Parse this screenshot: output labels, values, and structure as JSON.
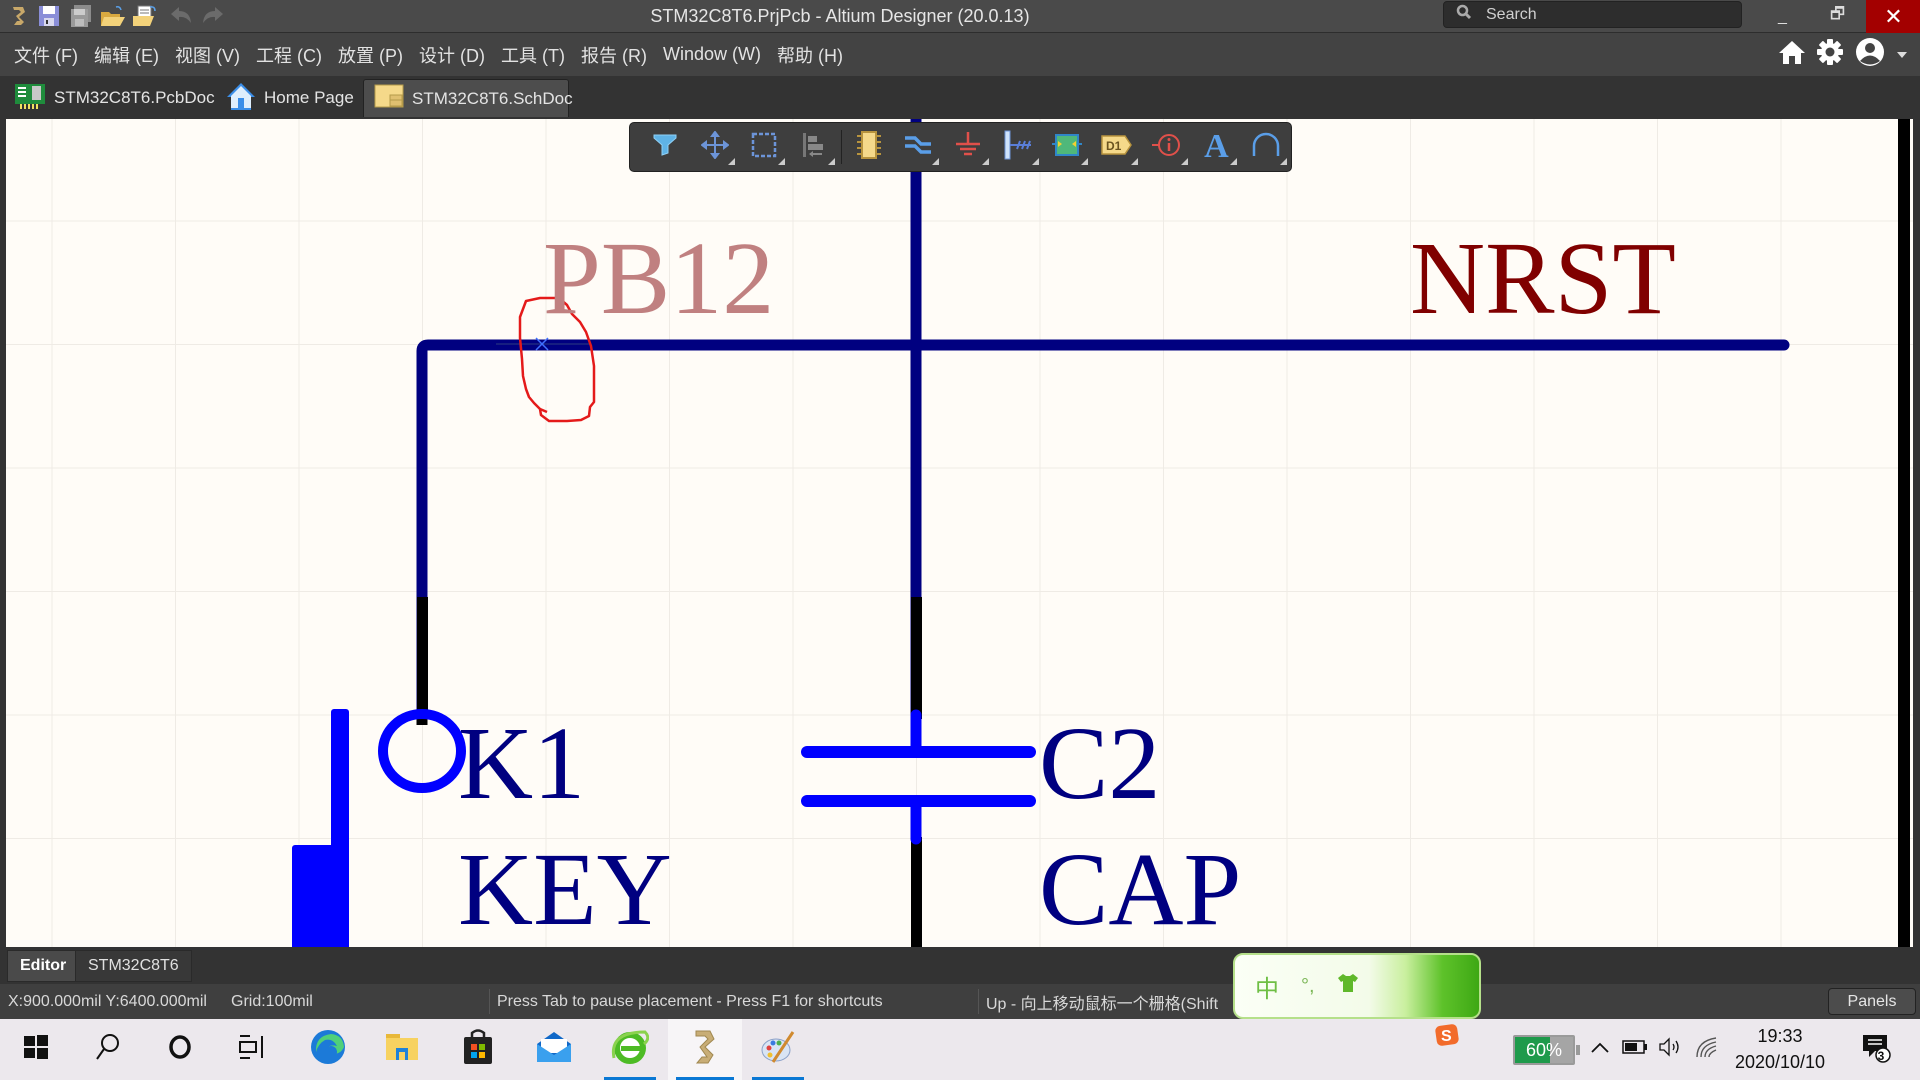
{
  "window": {
    "title": "STM32C8T6.PrjPcb - Altium Designer (20.0.13)",
    "search_placeholder": "Search",
    "minimize": "_",
    "restore": "🗗",
    "close": "✕"
  },
  "menu": {
    "items": [
      "文件 (F)",
      "编辑 (E)",
      "视图 (V)",
      "工程 (C)",
      "放置 (P)",
      "设计 (D)",
      "工具 (T)",
      "报告 (R)",
      "Window (W)",
      "帮助 (H)"
    ]
  },
  "doc_tabs": [
    {
      "label": "STM32C8T6.PcbDoc",
      "icon": "pcb-doc-icon",
      "active": false
    },
    {
      "label": "Home Page",
      "icon": "home-icon",
      "active": false
    },
    {
      "label": "STM32C8T6.SchDoc",
      "icon": "sch-doc-icon",
      "active": true
    }
  ],
  "toolbar": {
    "buttons": [
      "filter",
      "move",
      "select-rect",
      "align",
      "part",
      "wire",
      "ground",
      "bus",
      "sheet-symbol",
      "port",
      "directive",
      "text",
      "arc"
    ],
    "port_label": "D1",
    "text_glyph": "A"
  },
  "schematic": {
    "net_labels": [
      {
        "text": "PB12",
        "color": "#c08080"
      },
      {
        "text": "NRST",
        "color": "#800000"
      }
    ],
    "components": [
      {
        "designator": "K1",
        "comment": "KEY"
      },
      {
        "designator": "C2",
        "comment": "CAP"
      }
    ],
    "colors": {
      "wire": "#000080",
      "pin": "#000000",
      "body": "#0000ff",
      "text": "#000080",
      "annotation": "#e01010",
      "grid": "#ece8e2",
      "background": "#fffcf7"
    }
  },
  "panel_tabs": [
    {
      "label": "Editor",
      "active": true
    },
    {
      "label": "STM32C8T6",
      "active": false
    }
  ],
  "status": {
    "coords": "X:900.000mil Y:6400.000mil",
    "grid": "Grid:100mil",
    "hint": "Press Tab to pause placement - Press F1 for shortcuts",
    "shortcut": "Up - 向上移动鼠标一个栅格(Shift",
    "panels_label": "Panels"
  },
  "ime": {
    "mode": "中",
    "punct": "°,"
  },
  "taskbar": {
    "apps": [
      "windows-start",
      "search",
      "cortana",
      "task-view",
      "edge",
      "file-explorer",
      "store",
      "mail",
      "ie-browser",
      "altium-designer",
      "paint"
    ],
    "battery_percent": 60,
    "battery_label": "60%",
    "time": "19:33",
    "date": "2020/10/10",
    "notifications": "3",
    "sogou": "S"
  }
}
